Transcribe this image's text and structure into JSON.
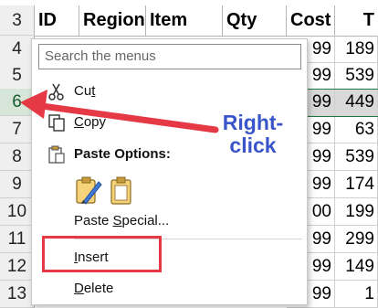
{
  "columns": [
    "ID",
    "Region",
    "Item",
    "Qty",
    "Cost",
    "T"
  ],
  "rows": [
    {
      "num": "3",
      "values": []
    },
    {
      "num": "4",
      "values": [
        "99",
        "189"
      ]
    },
    {
      "num": "5",
      "values": [
        "99",
        "539"
      ]
    },
    {
      "num": "6",
      "values": [
        "99",
        "449"
      ]
    },
    {
      "num": "7",
      "values": [
        "99",
        "63"
      ]
    },
    {
      "num": "8",
      "values": [
        "99",
        "539"
      ]
    },
    {
      "num": "9",
      "values": [
        "99",
        "174"
      ]
    },
    {
      "num": "10",
      "values": [
        "00",
        "199"
      ]
    },
    {
      "num": "11",
      "values": [
        "99",
        "299"
      ]
    },
    {
      "num": "12",
      "values": [
        "99",
        "149"
      ]
    },
    {
      "num": "13",
      "values": [
        "99",
        "1"
      ]
    }
  ],
  "menu": {
    "search_placeholder": "Search the menus",
    "cut": {
      "accel": "t",
      "pre": "Cu"
    },
    "copy": {
      "accel": "C",
      "post": "opy"
    },
    "paste_options": "Paste Options:",
    "paste_special": {
      "pre": "Paste ",
      "accel": "S",
      "post": "pecial..."
    },
    "insert": {
      "accel": "I",
      "post": "nsert"
    },
    "delete": {
      "accel": "D",
      "post": "elete"
    }
  },
  "annotation": {
    "line1": "Right-",
    "line2": "click"
  },
  "colors": {
    "arrow": "#e53945",
    "annotation": "#3a55c9",
    "selected_row": "#1f7a3f"
  }
}
